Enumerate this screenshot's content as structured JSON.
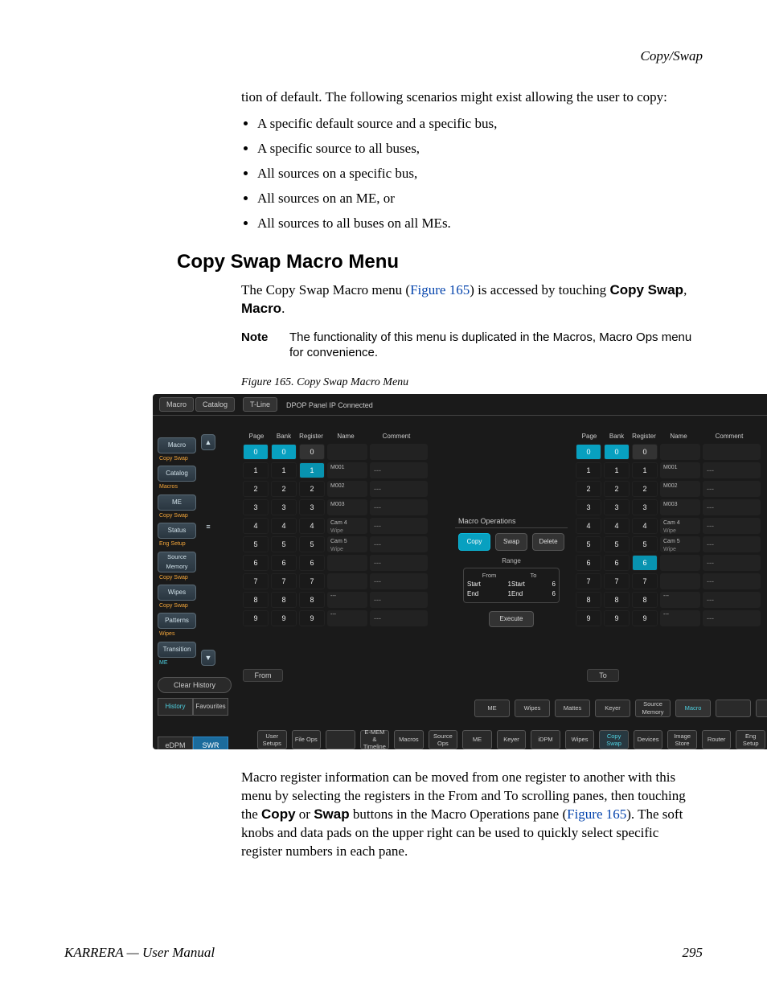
{
  "running_head": "Copy/Swap",
  "intro_tail": "tion of default. The following scenarios might exist allowing the user to copy:",
  "bullets": [
    "A specific default source and a specific bus,",
    "A specific source to all buses,",
    "All sources on a specific bus,",
    "All sources on an ME, or",
    "All sources to all buses on all MEs."
  ],
  "section_title": "Copy Swap Macro Menu",
  "para1_a": "The Copy Swap Macro menu (",
  "para1_link": "Figure 165",
  "para1_b": ") is accessed by touching ",
  "para1_bold1": "Copy Swap",
  "para1_mid": ", ",
  "para1_bold2": "Macro",
  "para1_end": ".",
  "note_label": "Note",
  "note_text": "The functionality of this menu is duplicated in the Macros, Macro Ops menu for convenience.",
  "fig_caption": "Figure 165.  Copy Swap Macro Menu",
  "para2_a": "Macro register information can be moved from one register to another with this menu by selecting the registers in the From and To scrolling panes, then touching the ",
  "para2_b1": "Copy",
  "para2_mid1": " or ",
  "para2_b2": "Swap",
  "para2_c": " buttons in the Macro Operations pane (",
  "para2_link": "Figure 165",
  "para2_d": "). The soft knobs and data pads on the upper right can be used to quickly select specific register numbers in each pane.",
  "footer_left": "KARRERA — User Manual",
  "footer_right": "295",
  "shot": {
    "tabs": {
      "a": "Macro",
      "b": "Catalog",
      "tline": "T-Line"
    },
    "conn": "DPOP Panel IP Connected",
    "up": "▲",
    "down": "▼",
    "menu": "≡",
    "side": [
      {
        "label": "Macro",
        "sub": "Copy Swap"
      },
      {
        "label": "Catalog",
        "sub": "Macros"
      },
      {
        "label": "ME",
        "sub": "Copy Swap"
      },
      {
        "label": "Status",
        "sub": "Eng Setup"
      },
      {
        "label": "Source Memory",
        "sub": "Copy Swap"
      },
      {
        "label": "Wipes",
        "sub": "Copy Swap"
      },
      {
        "label": "Patterns",
        "sub": "Wipes"
      },
      {
        "label": "Transition",
        "sub": "ME"
      }
    ],
    "clear": "Clear History",
    "hist": "History",
    "fav": "Favourites",
    "mode": {
      "a": "eDPM",
      "b": "SWR"
    },
    "headers": {
      "page": "Page",
      "bank": "Bank",
      "reg": "Register",
      "name": "Name",
      "comment": "Comment"
    },
    "names": {
      "m1": "M001",
      "m2": "M002",
      "m3": "M003",
      "c4": "Cam 4",
      "c5": "Cam 5",
      "wipe": "Wipe"
    },
    "dash": "---",
    "from": "From",
    "to": "To",
    "ops": {
      "title": "Macro Operations",
      "copy": "Copy",
      "swap": "Swap",
      "delete": "Delete",
      "range": "Range",
      "from": "From",
      "to": "To",
      "start": "Start",
      "end": "End",
      "f_start": "1",
      "f_end": "1",
      "t_start": "6",
      "t_end": "6",
      "exec": "Execute"
    },
    "sec": [
      "ME",
      "Wipes",
      "Mattes",
      "Keyer",
      "Source Memory",
      "Macro"
    ],
    "main": [
      "User Setups",
      "File Ops",
      "",
      "E-MEM & Timeline",
      "Macros",
      "Source Ops",
      "ME",
      "Keyer",
      "iDPM",
      "Wipes",
      "Copy Swap",
      "Devices",
      "Image Store",
      "Router",
      "Eng Setup"
    ]
  }
}
